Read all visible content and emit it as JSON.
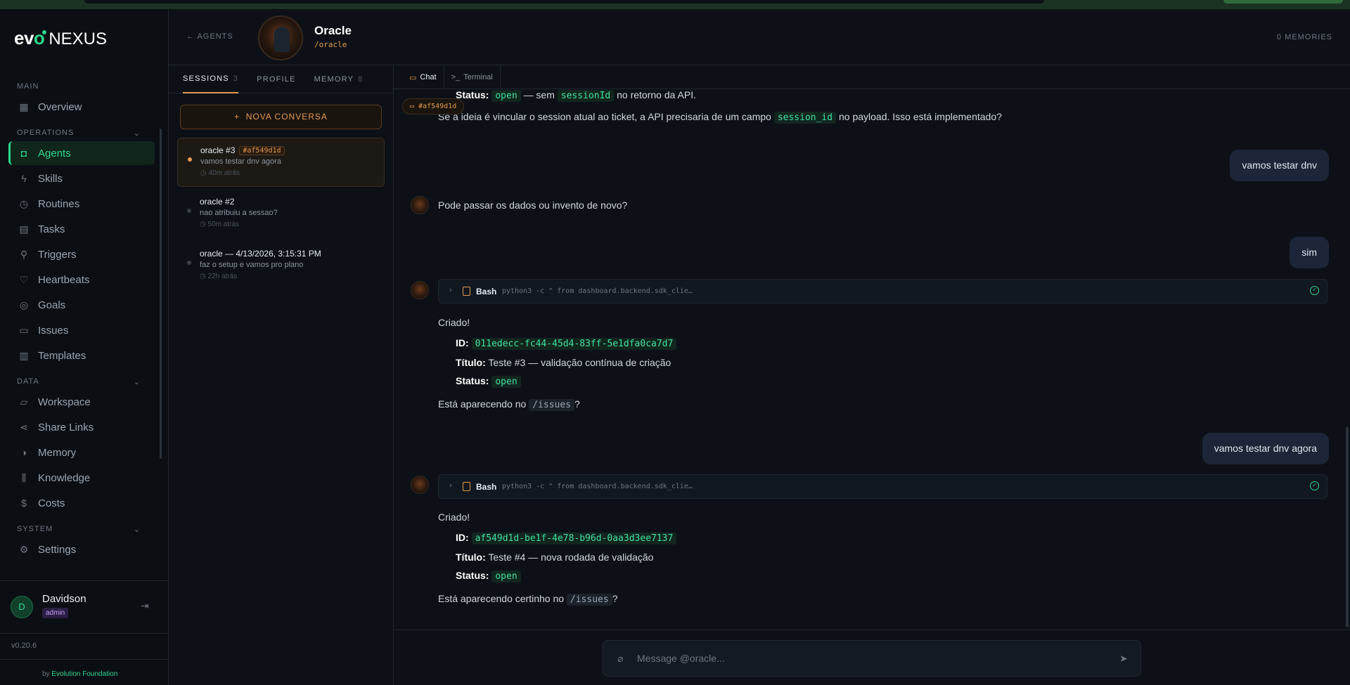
{
  "sidebar": {
    "brand": "NEXUS",
    "sections": [
      {
        "label": "MAIN"
      },
      {
        "label": "OPERATIONS"
      },
      {
        "label": "DATA"
      },
      {
        "label": "SYSTEM"
      }
    ],
    "items": {
      "overview": "Overview",
      "agents": "Agents",
      "skills": "Skills",
      "routines": "Routines",
      "tasks": "Tasks",
      "triggers": "Triggers",
      "heartbeats": "Heartbeats",
      "goals": "Goals",
      "issues": "Issues",
      "templates": "Templates",
      "workspace": "Workspace",
      "share_links": "Share Links",
      "memory": "Memory",
      "knowledge": "Knowledge",
      "costs": "Costs",
      "settings": "Settings"
    },
    "user": {
      "initial": "D",
      "name": "Davidson",
      "role": "admin"
    },
    "version": "v0.20.6",
    "byline_prefix": "by",
    "byline_org": "Evolution Foundation"
  },
  "header": {
    "back_label": "AGENTS",
    "agent_name": "Oracle",
    "agent_slug": "/oracle",
    "memories": "0 MEMORIES"
  },
  "sessions_panel": {
    "tabs": [
      {
        "label": "SESSIONS",
        "count": "3"
      },
      {
        "label": "PROFILE",
        "count": ""
      },
      {
        "label": "MEMORY",
        "count": "8"
      }
    ],
    "new_conversation": "NOVA CONVERSA",
    "sessions": [
      {
        "title": "oracle #3",
        "tag": "#af549d1d",
        "preview": "vamos testar dnv agora",
        "ago": "40m atrás"
      },
      {
        "title": "oracle #2",
        "tag": "",
        "preview": "nao atribuiu a sessao?",
        "ago": "50m atrás"
      },
      {
        "title": "oracle — 4/13/2026, 3:15:31 PM",
        "tag": "",
        "preview": "faz o setup e vamos pro plano",
        "ago": "22h atrás"
      }
    ]
  },
  "chat": {
    "tabs": [
      {
        "label": "Chat"
      },
      {
        "label": "Terminal"
      }
    ],
    "floating_tag": "#af549d1d",
    "status_line": {
      "label": "Status:",
      "code1": "open",
      "mid": "— sem",
      "code2": "sessionId",
      "tail": "no retorno da API."
    },
    "idea_line": {
      "pre": "Se a ideia é vincular o session atual ao ticket, a API precisaria de um campo",
      "code": "session_id",
      "post": "no payload. Isso está implementado?"
    },
    "user_msg_1": "vamos testar dnv",
    "bot_msg_1": "Pode passar os dados ou invento de novo?",
    "user_msg_2": "sim",
    "tool_1": {
      "name": "Bash",
      "cmd": "python3 -c \" from dashboard.backend.sdk_clie…"
    },
    "created_1": {
      "title": "Criado!",
      "id_label": "ID:",
      "id": "011edecc-fc44-45d4-83ff-5e1dfa0ca7d7",
      "titulo_label": "Título:",
      "titulo": "Teste #3 — validação contínua de criação",
      "status_label": "Status:",
      "status": "open",
      "question_pre": "Está aparecendo no",
      "question_code": "/issues",
      "question_post": "?"
    },
    "user_msg_3": "vamos testar dnv agora",
    "tool_2": {
      "name": "Bash",
      "cmd": "python3 -c \" from dashboard.backend.sdk_clie…"
    },
    "created_2": {
      "title": "Criado!",
      "id_label": "ID:",
      "id": "af549d1d-be1f-4e78-b96d-0aa3d3ee7137",
      "titulo_label": "Título:",
      "titulo": "Teste #4 — nova rodada de validação",
      "status_label": "Status:",
      "status": "open",
      "question_pre": "Está aparecendo certinho no",
      "question_code": "/issues",
      "question_post": "?"
    },
    "input_placeholder": "Message @oracle..."
  },
  "colors": {
    "accent_green": "#2fd68b",
    "accent_orange": "#e39a4f",
    "bg": "#0d1117"
  }
}
